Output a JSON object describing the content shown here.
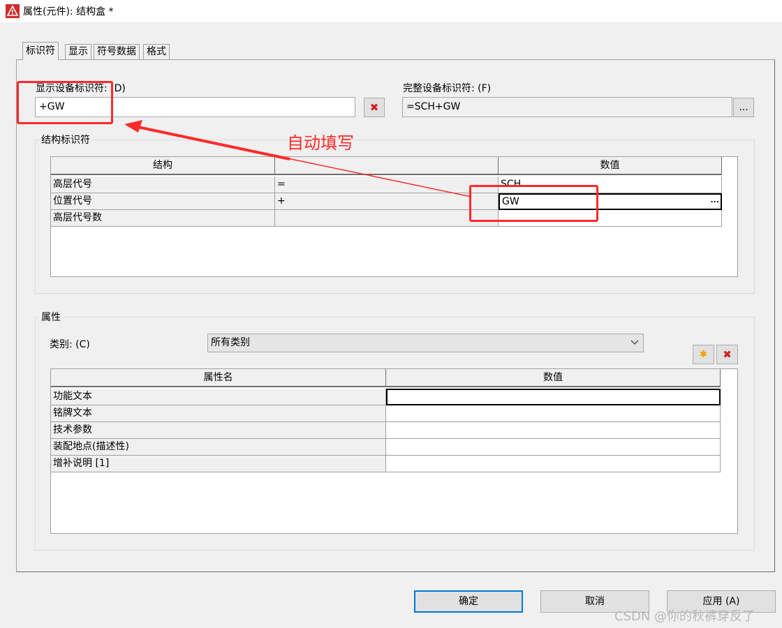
{
  "window": {
    "title": "属性(元件): 结构盒 *"
  },
  "tabs": [
    {
      "label": "标识符"
    },
    {
      "label": "显示"
    },
    {
      "label": "符号数据"
    },
    {
      "label": "格式"
    }
  ],
  "identifier": {
    "display_label": "显示设备标识符: (D)",
    "display_value": "+GW",
    "full_label": "完整设备标识符: (F)",
    "full_value": "=SCH+GW",
    "browse_label": "..."
  },
  "structure": {
    "group_title": "结构标识符",
    "headers": [
      "结构",
      "",
      "数值"
    ],
    "rows": [
      {
        "name": "高层代号",
        "prefix": "=",
        "value": "SCH"
      },
      {
        "name": "位置代号",
        "prefix": "+",
        "value": "GW"
      },
      {
        "name": "高层代号数",
        "prefix": "",
        "value": ""
      }
    ],
    "cell_button": "..."
  },
  "properties": {
    "group_title": "属性",
    "category_label": "类别: (C)",
    "category_value": "所有类别",
    "headers": [
      "属性名",
      "数值"
    ],
    "rows": [
      {
        "name": "功能文本",
        "value": ""
      },
      {
        "name": "铭牌文本",
        "value": ""
      },
      {
        "name": "技术参数",
        "value": ""
      },
      {
        "name": "装配地点(描述性)",
        "value": ""
      },
      {
        "name": "增补说明 [1]",
        "value": ""
      }
    ]
  },
  "buttons": {
    "ok": "确定",
    "cancel": "取消",
    "apply": "应用 (A)"
  },
  "annotation": {
    "text": "自动填写",
    "color": "#ff2a2a"
  },
  "watermark": "CSDN @你的秋裤穿反了",
  "icons": {
    "app": "eplan-warning-icon",
    "delete": "delete-x-icon",
    "new": "new-star-icon",
    "dropdown": "chevron-down-icon"
  }
}
